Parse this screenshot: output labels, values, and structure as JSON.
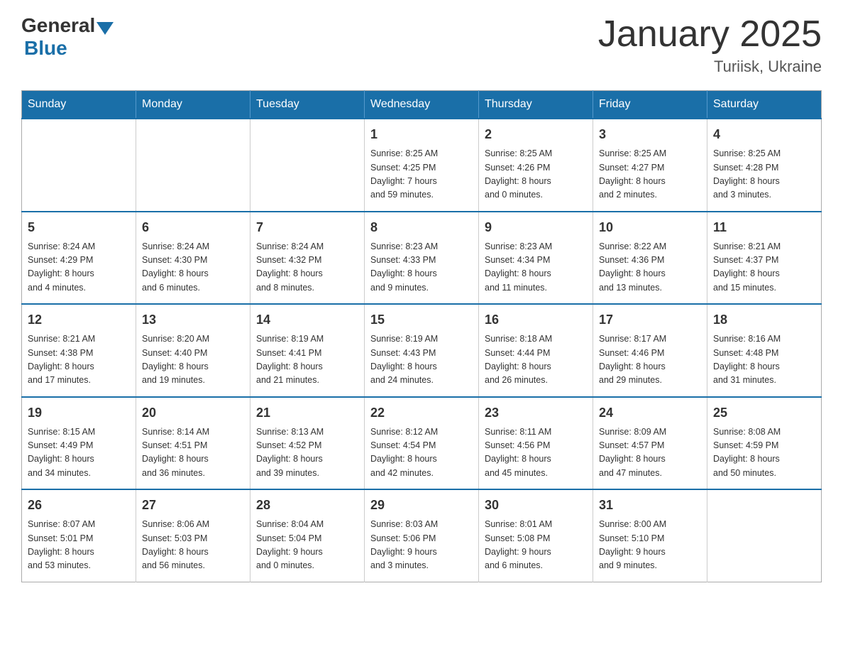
{
  "logo": {
    "general": "General",
    "blue": "Blue"
  },
  "header": {
    "title": "January 2025",
    "location": "Turiisk, Ukraine"
  },
  "days_of_week": [
    "Sunday",
    "Monday",
    "Tuesday",
    "Wednesday",
    "Thursday",
    "Friday",
    "Saturday"
  ],
  "weeks": [
    [
      {
        "day": "",
        "info": ""
      },
      {
        "day": "",
        "info": ""
      },
      {
        "day": "",
        "info": ""
      },
      {
        "day": "1",
        "info": "Sunrise: 8:25 AM\nSunset: 4:25 PM\nDaylight: 7 hours\nand 59 minutes."
      },
      {
        "day": "2",
        "info": "Sunrise: 8:25 AM\nSunset: 4:26 PM\nDaylight: 8 hours\nand 0 minutes."
      },
      {
        "day": "3",
        "info": "Sunrise: 8:25 AM\nSunset: 4:27 PM\nDaylight: 8 hours\nand 2 minutes."
      },
      {
        "day": "4",
        "info": "Sunrise: 8:25 AM\nSunset: 4:28 PM\nDaylight: 8 hours\nand 3 minutes."
      }
    ],
    [
      {
        "day": "5",
        "info": "Sunrise: 8:24 AM\nSunset: 4:29 PM\nDaylight: 8 hours\nand 4 minutes."
      },
      {
        "day": "6",
        "info": "Sunrise: 8:24 AM\nSunset: 4:30 PM\nDaylight: 8 hours\nand 6 minutes."
      },
      {
        "day": "7",
        "info": "Sunrise: 8:24 AM\nSunset: 4:32 PM\nDaylight: 8 hours\nand 8 minutes."
      },
      {
        "day": "8",
        "info": "Sunrise: 8:23 AM\nSunset: 4:33 PM\nDaylight: 8 hours\nand 9 minutes."
      },
      {
        "day": "9",
        "info": "Sunrise: 8:23 AM\nSunset: 4:34 PM\nDaylight: 8 hours\nand 11 minutes."
      },
      {
        "day": "10",
        "info": "Sunrise: 8:22 AM\nSunset: 4:36 PM\nDaylight: 8 hours\nand 13 minutes."
      },
      {
        "day": "11",
        "info": "Sunrise: 8:21 AM\nSunset: 4:37 PM\nDaylight: 8 hours\nand 15 minutes."
      }
    ],
    [
      {
        "day": "12",
        "info": "Sunrise: 8:21 AM\nSunset: 4:38 PM\nDaylight: 8 hours\nand 17 minutes."
      },
      {
        "day": "13",
        "info": "Sunrise: 8:20 AM\nSunset: 4:40 PM\nDaylight: 8 hours\nand 19 minutes."
      },
      {
        "day": "14",
        "info": "Sunrise: 8:19 AM\nSunset: 4:41 PM\nDaylight: 8 hours\nand 21 minutes."
      },
      {
        "day": "15",
        "info": "Sunrise: 8:19 AM\nSunset: 4:43 PM\nDaylight: 8 hours\nand 24 minutes."
      },
      {
        "day": "16",
        "info": "Sunrise: 8:18 AM\nSunset: 4:44 PM\nDaylight: 8 hours\nand 26 minutes."
      },
      {
        "day": "17",
        "info": "Sunrise: 8:17 AM\nSunset: 4:46 PM\nDaylight: 8 hours\nand 29 minutes."
      },
      {
        "day": "18",
        "info": "Sunrise: 8:16 AM\nSunset: 4:48 PM\nDaylight: 8 hours\nand 31 minutes."
      }
    ],
    [
      {
        "day": "19",
        "info": "Sunrise: 8:15 AM\nSunset: 4:49 PM\nDaylight: 8 hours\nand 34 minutes."
      },
      {
        "day": "20",
        "info": "Sunrise: 8:14 AM\nSunset: 4:51 PM\nDaylight: 8 hours\nand 36 minutes."
      },
      {
        "day": "21",
        "info": "Sunrise: 8:13 AM\nSunset: 4:52 PM\nDaylight: 8 hours\nand 39 minutes."
      },
      {
        "day": "22",
        "info": "Sunrise: 8:12 AM\nSunset: 4:54 PM\nDaylight: 8 hours\nand 42 minutes."
      },
      {
        "day": "23",
        "info": "Sunrise: 8:11 AM\nSunset: 4:56 PM\nDaylight: 8 hours\nand 45 minutes."
      },
      {
        "day": "24",
        "info": "Sunrise: 8:09 AM\nSunset: 4:57 PM\nDaylight: 8 hours\nand 47 minutes."
      },
      {
        "day": "25",
        "info": "Sunrise: 8:08 AM\nSunset: 4:59 PM\nDaylight: 8 hours\nand 50 minutes."
      }
    ],
    [
      {
        "day": "26",
        "info": "Sunrise: 8:07 AM\nSunset: 5:01 PM\nDaylight: 8 hours\nand 53 minutes."
      },
      {
        "day": "27",
        "info": "Sunrise: 8:06 AM\nSunset: 5:03 PM\nDaylight: 8 hours\nand 56 minutes."
      },
      {
        "day": "28",
        "info": "Sunrise: 8:04 AM\nSunset: 5:04 PM\nDaylight: 9 hours\nand 0 minutes."
      },
      {
        "day": "29",
        "info": "Sunrise: 8:03 AM\nSunset: 5:06 PM\nDaylight: 9 hours\nand 3 minutes."
      },
      {
        "day": "30",
        "info": "Sunrise: 8:01 AM\nSunset: 5:08 PM\nDaylight: 9 hours\nand 6 minutes."
      },
      {
        "day": "31",
        "info": "Sunrise: 8:00 AM\nSunset: 5:10 PM\nDaylight: 9 hours\nand 9 minutes."
      },
      {
        "day": "",
        "info": ""
      }
    ]
  ]
}
